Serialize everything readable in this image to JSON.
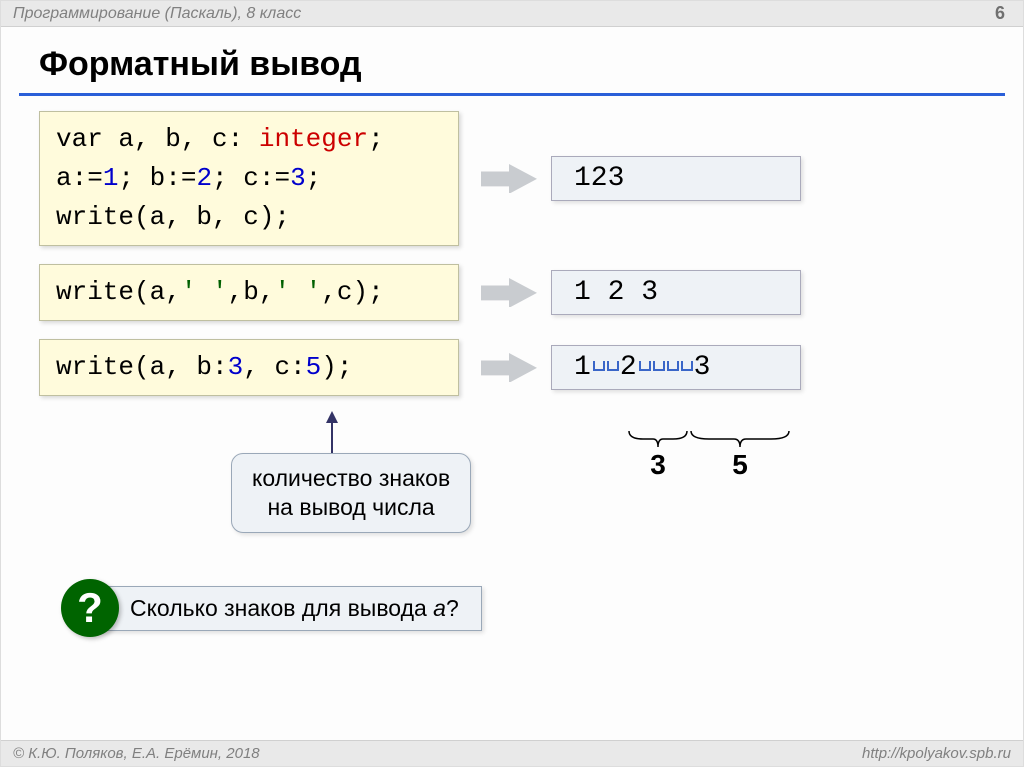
{
  "header": {
    "subject": "Программирование (Паскаль), 8 класс",
    "page": "6"
  },
  "title": "Форматный вывод",
  "block1": {
    "line1_pre": "var",
    "line1_vars": " a, b, c: ",
    "line1_type": "integer",
    "line1_end": ";",
    "line2_a": "a:=",
    "line2_av": "1",
    "line2_b": "; b:=",
    "line2_bv": "2",
    "line2_c": "; c:=",
    "line2_cv": "3",
    "line2_end": ";",
    "line3": "write(a, b, c);",
    "output": "123"
  },
  "block2": {
    "code_pre": "write(a,",
    "code_s1": "' '",
    "code_mid": ",b,",
    "code_s2": "' '",
    "code_end": ",c);",
    "output": "1 2 3"
  },
  "block3": {
    "code_pre": "write(a, b:",
    "code_n1": "3",
    "code_mid": ", c:",
    "code_n2": "5",
    "code_end": ");",
    "out_1": "1",
    "out_2": "2",
    "out_3": "3",
    "brace1": "3",
    "brace2": "5"
  },
  "callout": {
    "line1": "количество знаков",
    "line2": "на вывод числа"
  },
  "question": {
    "mark": "?",
    "text_pre": "Сколько знаков для вывода ",
    "text_var": "a",
    "text_post": "?"
  },
  "footer": {
    "left": "© К.Ю. Поляков, Е.А. Ерёмин, 2018",
    "right": "http://kpolyakov.spb.ru"
  }
}
